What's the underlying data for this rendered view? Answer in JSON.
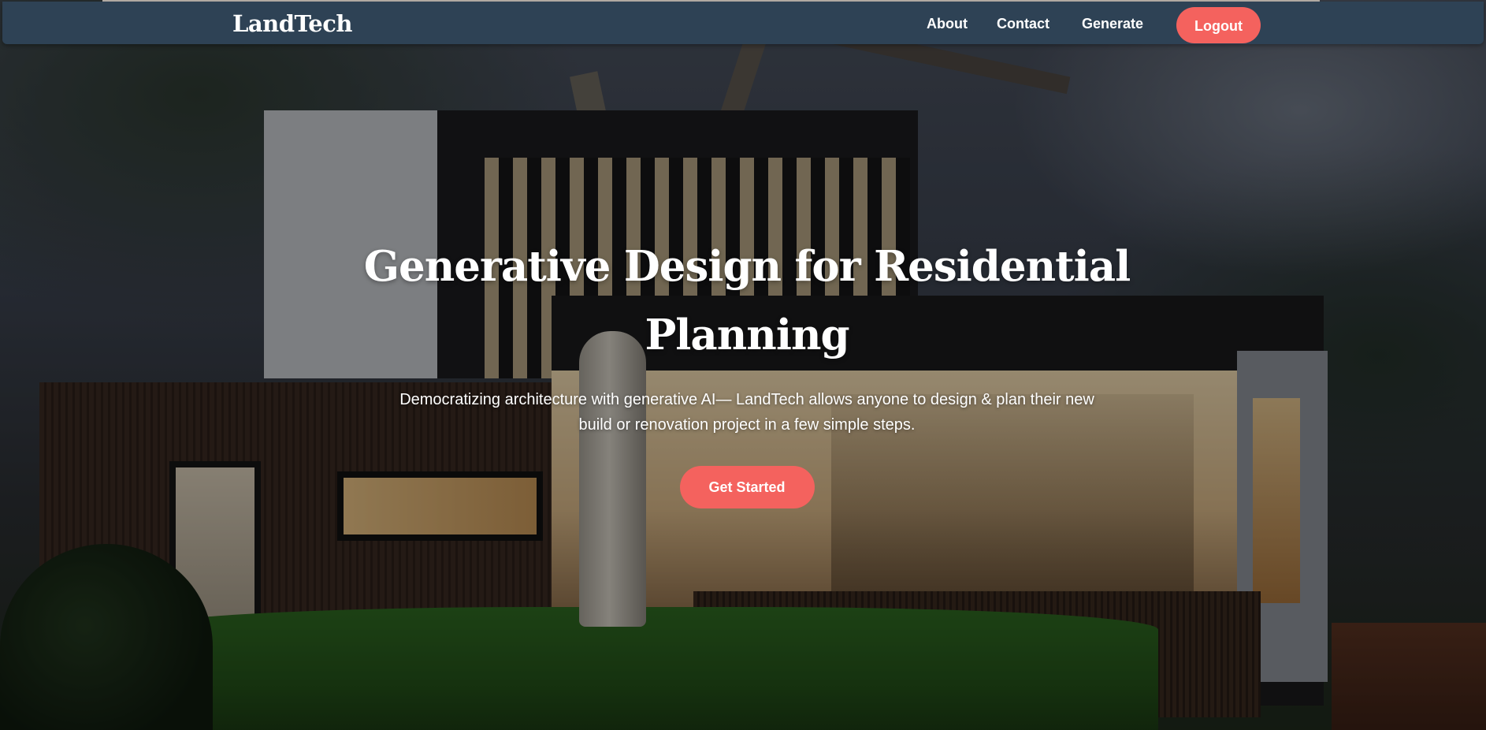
{
  "navbar": {
    "brand": "LandTech",
    "links": [
      {
        "label": "About"
      },
      {
        "label": "Contact"
      },
      {
        "label": "Generate"
      }
    ],
    "logout_label": "Logout"
  },
  "hero": {
    "title": "Generative Design for Residential Planning",
    "subtitle": "Democratizing architecture with generative AI— LandTech allows anyone to design & plan their new build or renovation project in a few simple steps.",
    "cta_label": "Get Started"
  },
  "colors": {
    "navbar_bg": "#2e4255",
    "accent": "#f4625e",
    "text": "#ffffff"
  }
}
